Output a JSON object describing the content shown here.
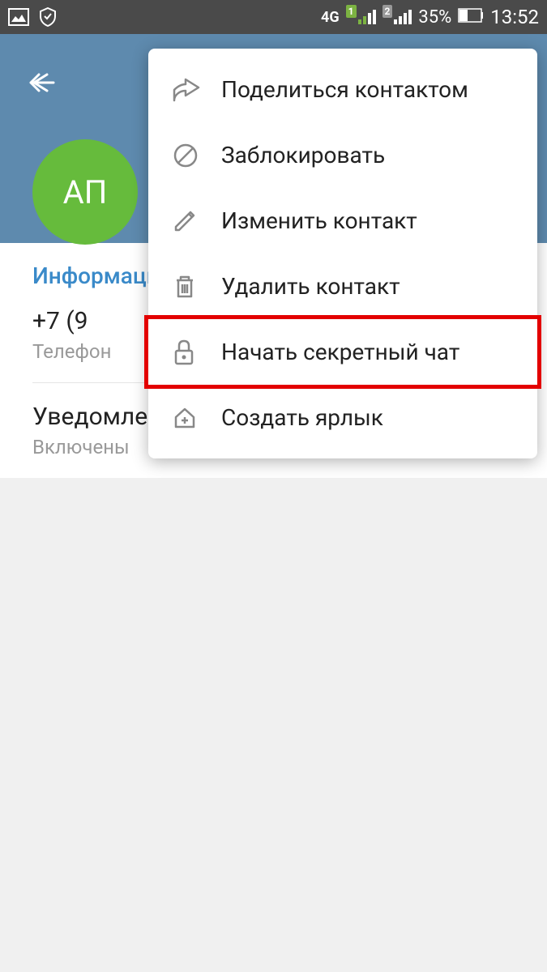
{
  "status_bar": {
    "network_type": "4G",
    "sim1": "1",
    "sim2": "2",
    "battery_percent": "35%",
    "time": "13:52"
  },
  "header": {
    "avatar_initials": "АП"
  },
  "info": {
    "section_title": "Информаци",
    "phone_value": "+7 (9",
    "phone_label": "Телефон"
  },
  "notifications": {
    "title": "Уведомле",
    "value": "Включены"
  },
  "menu": {
    "items": [
      {
        "label": "Поделиться контактом"
      },
      {
        "label": "Заблокировать"
      },
      {
        "label": "Изменить контакт"
      },
      {
        "label": "Удалить контакт"
      },
      {
        "label": "Начать секретный чат"
      },
      {
        "label": "Создать ярлык"
      }
    ]
  }
}
